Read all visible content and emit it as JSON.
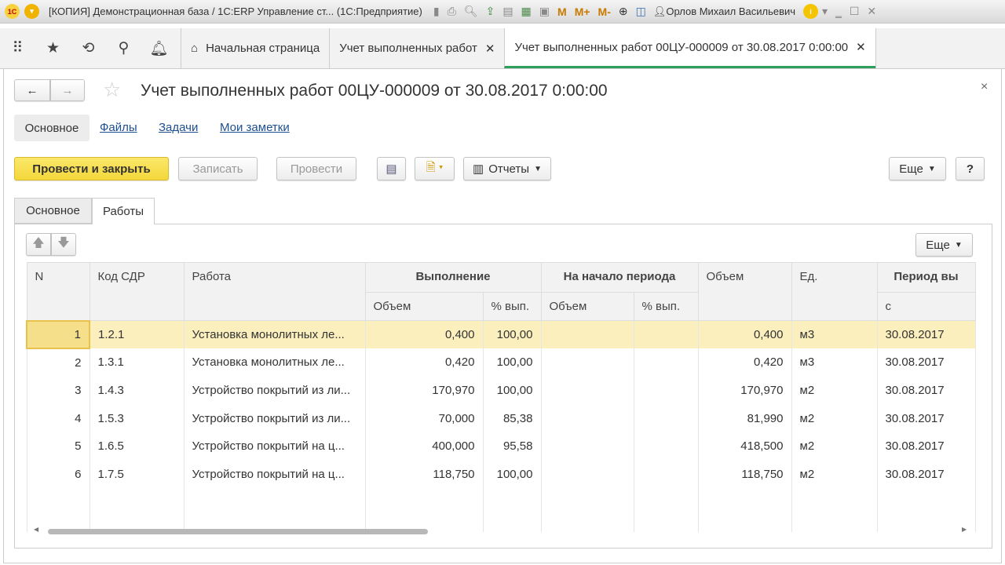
{
  "window": {
    "title": "[КОПИЯ] Демонстрационная база / 1С:ERP Управление ст...  (1С:Предприятие)",
    "user": "Орлов Михаил Васильевич",
    "m": "M",
    "mplus": "M+",
    "mminus": "M-"
  },
  "tabs": [
    {
      "label": "Начальная страница"
    },
    {
      "label": "Учет выполненных работ"
    },
    {
      "label": "Учет выполненных работ 00ЦУ-000009 от 30.08.2017 0:00:00"
    }
  ],
  "doc": {
    "title": "Учет выполненных работ 00ЦУ-000009 от 30.08.2017 0:00:00",
    "nav": [
      "Основное",
      "Файлы",
      "Задачи",
      "Мои заметки"
    ],
    "buttons": {
      "post_close": "Провести и закрыть",
      "save": "Записать",
      "post": "Провести",
      "reports": "Отчеты",
      "more": "Еще",
      "help": "?"
    },
    "form_tabs": [
      "Основное",
      "Работы"
    ],
    "table_more": "Еще"
  },
  "table": {
    "headers": {
      "n": "N",
      "code": "Код СДР",
      "work": "Работа",
      "exec": "Выполнение",
      "start": "На начало периода",
      "vol_total": "Объем",
      "unit": "Ед.",
      "period": "Период вы",
      "vol": "Объем",
      "pct": "% вып.",
      "from": "с"
    },
    "rows": [
      {
        "n": "1",
        "code": "1.2.1",
        "work": "Установка монолитных ле...",
        "vol": "0,400",
        "pct": "100,00",
        "svol": "",
        "spct": "",
        "total": "0,400",
        "unit": "м3",
        "date": "30.08.2017"
      },
      {
        "n": "2",
        "code": "1.3.1",
        "work": "Установка монолитных ле...",
        "vol": "0,420",
        "pct": "100,00",
        "svol": "",
        "spct": "",
        "total": "0,420",
        "unit": "м3",
        "date": "30.08.2017"
      },
      {
        "n": "3",
        "code": "1.4.3",
        "work": "Устройство покрытий из ли...",
        "vol": "170,970",
        "pct": "100,00",
        "svol": "",
        "spct": "",
        "total": "170,970",
        "unit": "м2",
        "date": "30.08.2017"
      },
      {
        "n": "4",
        "code": "1.5.3",
        "work": "Устройство покрытий из ли...",
        "vol": "70,000",
        "pct": "85,38",
        "svol": "",
        "spct": "",
        "total": "81,990",
        "unit": "м2",
        "date": "30.08.2017"
      },
      {
        "n": "5",
        "code": "1.6.5",
        "work": "Устройство покрытий на ц...",
        "vol": "400,000",
        "pct": "95,58",
        "svol": "",
        "spct": "",
        "total": "418,500",
        "unit": "м2",
        "date": "30.08.2017"
      },
      {
        "n": "6",
        "code": "1.7.5",
        "work": "Устройство покрытий на ц...",
        "vol": "118,750",
        "pct": "100,00",
        "svol": "",
        "spct": "",
        "total": "118,750",
        "unit": "м2",
        "date": "30.08.2017"
      }
    ]
  }
}
